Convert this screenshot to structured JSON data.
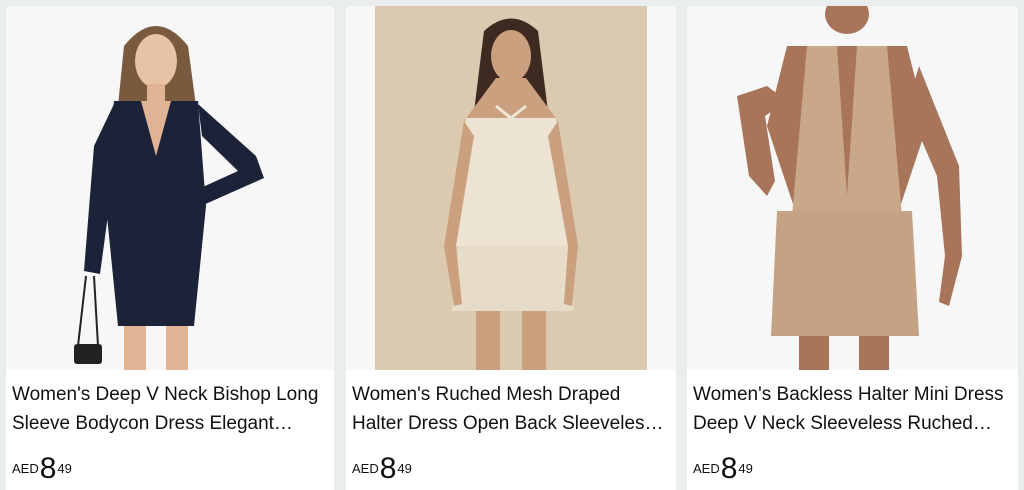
{
  "products": [
    {
      "image_alt": "Woman in navy deep V neck long sleeve bodycon dress",
      "title": "Women's Deep V Neck Bishop Long Sleeve Bodycon Dress Elegant…",
      "currency": "AED",
      "price_whole": "8",
      "price_fraction": "49",
      "dress_color": "#1c2238"
    },
    {
      "image_alt": "Woman in cream ruched mesh halter dress",
      "title": "Women's Ruched Mesh Draped Halter Dress Open Back Sleeveles…",
      "currency": "AED",
      "price_whole": "8",
      "price_fraction": "49",
      "dress_color": "#ece3d2"
    },
    {
      "image_alt": "Woman in beige backless halter mini dress",
      "title": "Women's Backless Halter Mini Dress Deep V Neck Sleeveless Ruched…",
      "currency": "AED",
      "price_whole": "8",
      "price_fraction": "49",
      "dress_color": "#c9a88a"
    }
  ]
}
